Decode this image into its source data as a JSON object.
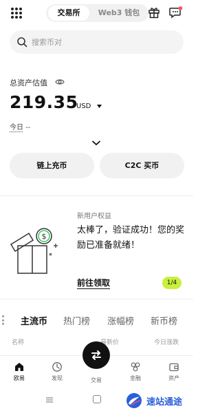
{
  "header": {
    "tabs": [
      {
        "label": "交易所",
        "active": true
      },
      {
        "label": "Web3 钱包",
        "active": false
      }
    ],
    "icons": [
      "grid-menu-icon",
      "gift-icon",
      "chat-icon"
    ],
    "notification_dot_color": "#ff4d6d"
  },
  "search": {
    "placeholder": "搜索币对"
  },
  "assets": {
    "label": "总资产估值",
    "value": "219.35",
    "currency": "USD",
    "today_label": "今日",
    "today_value": "--"
  },
  "actions": {
    "deposit_label": "链上充币",
    "c2c_label": "C2C 买币"
  },
  "promo": {
    "tag": "新用户权益",
    "text": "太棒了，验证成功！您的奖励已准备就绪！",
    "link_label": "前往领取",
    "pager": "1/4",
    "pager_color": "#c8f03c",
    "art_icon": "gift-box-dollar-icon"
  },
  "market": {
    "tabs": [
      {
        "label": "主流币",
        "active": true
      },
      {
        "label": "热门榜",
        "active": false
      },
      {
        "label": "涨幅榜",
        "active": false
      },
      {
        "label": "新币榜",
        "active": false
      }
    ],
    "columns": {
      "name": "名称",
      "price": "最新价",
      "change": "今日涨跌"
    }
  },
  "bottom_nav": {
    "items": [
      {
        "label": "欧易",
        "icon": "home-icon",
        "active": true
      },
      {
        "label": "发现",
        "icon": "discover-icon",
        "active": false
      },
      {
        "label": "交易",
        "icon": "trade-swap-icon",
        "active": false
      },
      {
        "label": "金融",
        "icon": "finance-icon",
        "active": false
      },
      {
        "label": "资产",
        "icon": "wallet-icon",
        "active": false
      }
    ]
  },
  "watermark": {
    "text": "速站通途"
  }
}
